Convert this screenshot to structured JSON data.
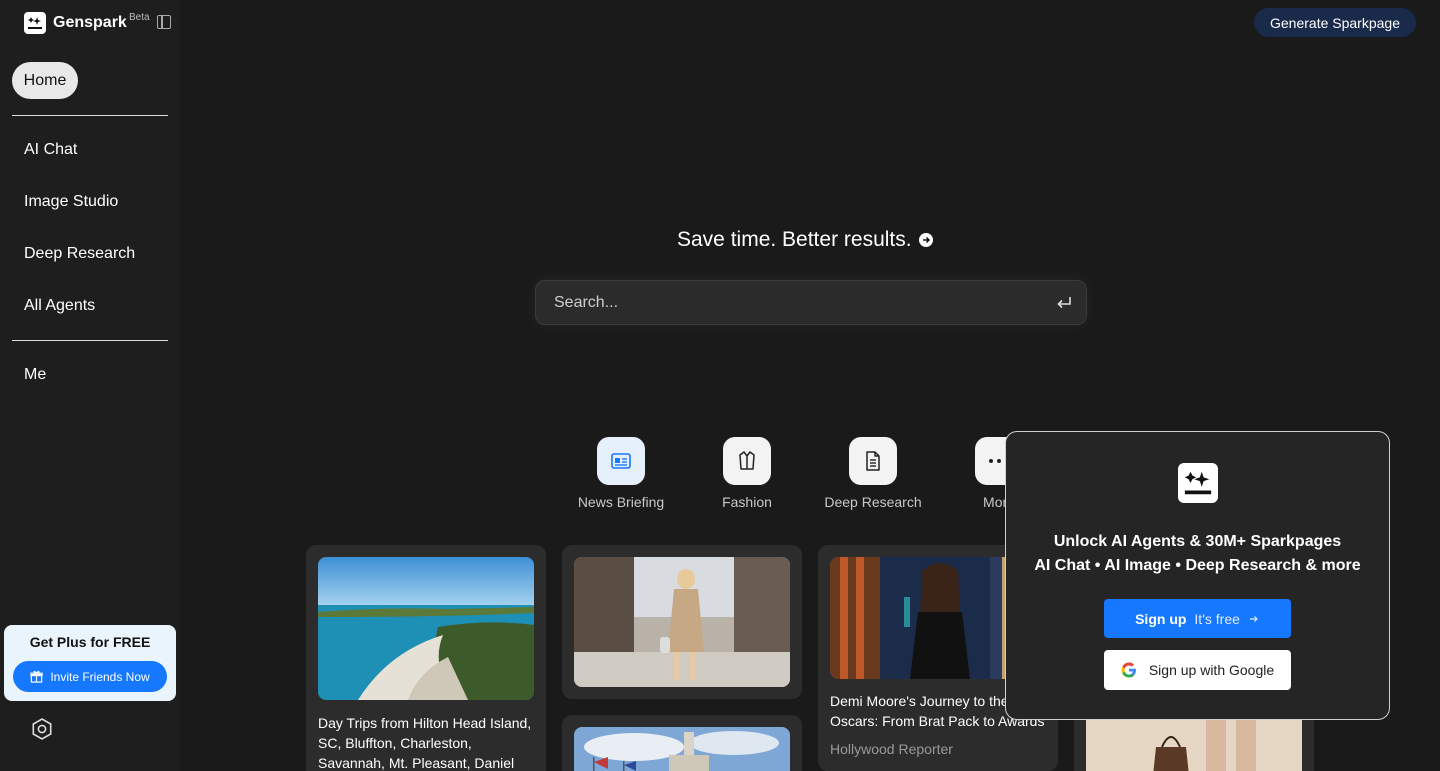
{
  "app": {
    "name": "Genspark",
    "badge": "Beta"
  },
  "sidebar": {
    "home_label": "Home",
    "items": [
      {
        "label": "AI Chat"
      },
      {
        "label": "Image Studio"
      },
      {
        "label": "Deep Research"
      },
      {
        "label": "All Agents"
      }
    ],
    "me_label": "Me",
    "plus_card": {
      "title": "Get Plus for FREE",
      "button": "Invite Friends Now"
    }
  },
  "header": {
    "generate_button": "Generate Sparkpage"
  },
  "hero": {
    "tagline": "Save time. Better results.",
    "search_placeholder": "Search..."
  },
  "agents": [
    {
      "label": "News Briefing",
      "icon": "newspaper-icon"
    },
    {
      "label": "Fashion",
      "icon": "coat-icon"
    },
    {
      "label": "Deep Research",
      "icon": "document-icon"
    },
    {
      "label": "More",
      "icon": "more-dots-icon"
    }
  ],
  "cards": [
    {
      "title_lines": [
        "Day Trips from Hilton Head Island,",
        "SC, Bluffton, Charleston,",
        "Savannah, Mt. Pleasant, Daniel"
      ],
      "image": "coastal-aerial"
    },
    {
      "title_lines": [],
      "image": "street-fashion"
    },
    {
      "title_lines": [
        "Demi Moore's Journey to the",
        "Oscars: From Brat Pack to Awards"
      ],
      "source": "Hollywood Reporter",
      "image": "awards-stage"
    },
    {
      "title_lines": [],
      "image": "city-flags"
    },
    {
      "title_lines": [],
      "image": "fashion-legs"
    }
  ],
  "popup": {
    "title_line1": "Unlock AI Agents & 30M+ Sparkpages",
    "title_line2": "AI Chat • AI Image • Deep Research & more",
    "signup_label": "Sign up",
    "signup_sub": "It's free",
    "google_label": "Sign up with Google"
  },
  "colors": {
    "accent": "#1677ff",
    "background": "#1a1a1a",
    "sidebar": "#1e1e1e",
    "card": "#2c2c2c"
  }
}
